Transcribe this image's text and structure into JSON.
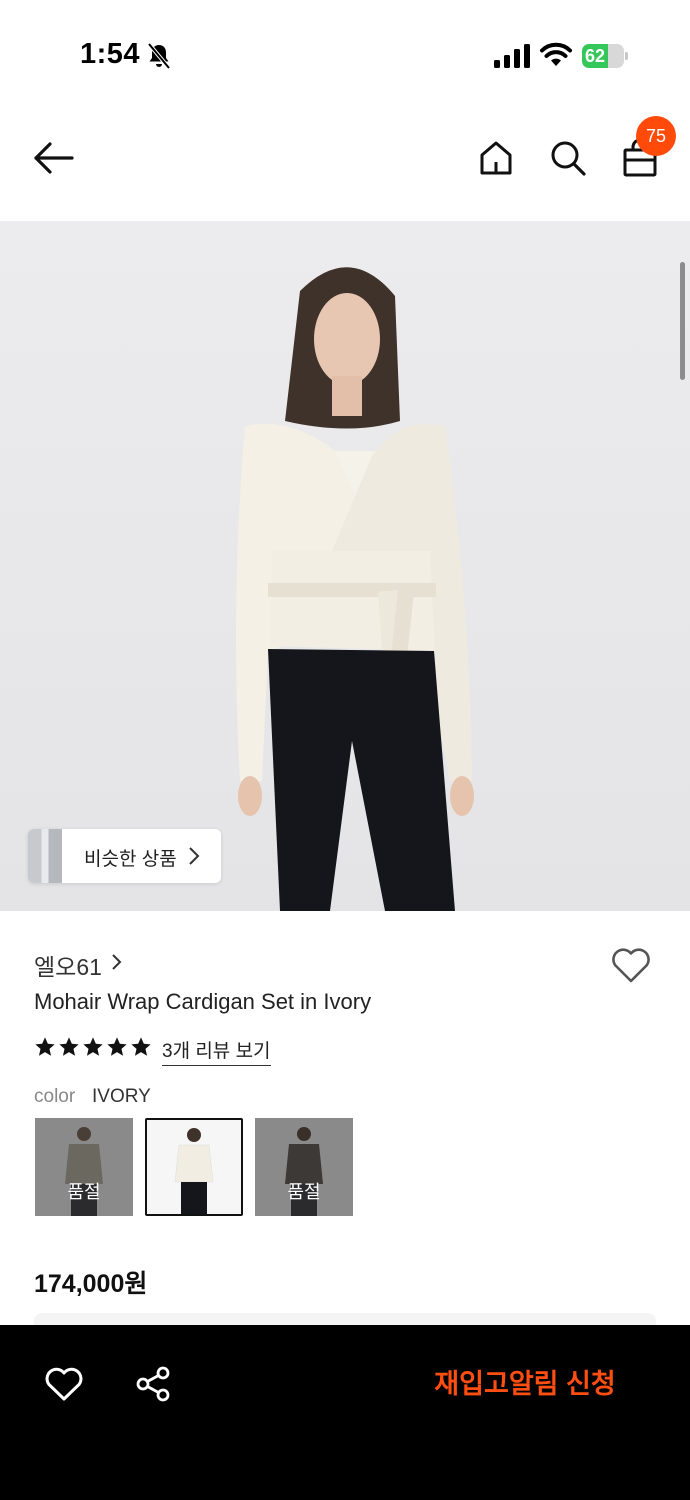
{
  "status_bar": {
    "time": "1:54",
    "battery_level": "62",
    "icons": [
      "bell-off-icon",
      "cellular-signal-icon",
      "wifi-icon",
      "battery-charging-icon"
    ]
  },
  "header": {
    "icons": [
      "back-arrow-icon",
      "home-icon",
      "search-icon",
      "shopping-bag-icon"
    ],
    "cart_count": "75"
  },
  "hero": {
    "similar_products_label": "비슷한 상품",
    "chevron_icon": "chevron-right-icon"
  },
  "product": {
    "brand": "엘오61",
    "name": "Mohair Wrap Cardigan Set in Ivory",
    "rating_stars": 5,
    "review_link": "3개 리뷰 보기",
    "color_label": "color",
    "color_value": "IVORY",
    "swatches": [
      {
        "status": "품절",
        "selected": false
      },
      {
        "status": "",
        "selected": true
      },
      {
        "status": "품절",
        "selected": false
      }
    ],
    "price": "174,000원"
  },
  "bottom_bar": {
    "icons": [
      "heart-outline-icon",
      "share-icon"
    ],
    "cta_label": "재입고알림 신청"
  },
  "colors": {
    "accent": "#ff4a0a",
    "cta_text": "#ff4e12",
    "bottom_bar_bg": "#000000",
    "battery_green": "#35c759"
  }
}
